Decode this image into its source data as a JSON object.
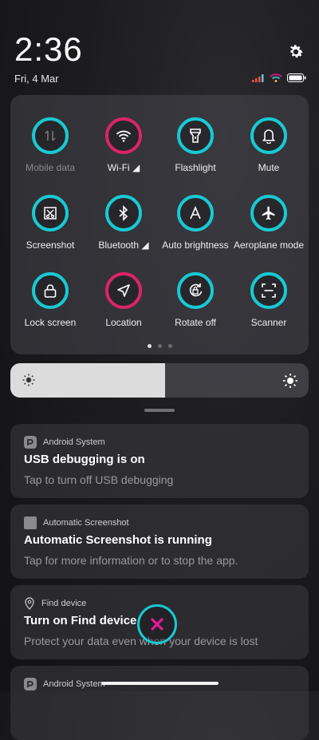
{
  "status": {
    "time": "2:36",
    "date": "Fri, 4 Mar"
  },
  "tiles": [
    {
      "label": "Mobile data",
      "icon": "mobile-data-icon",
      "active": false
    },
    {
      "label": "Wi-Fi ◢",
      "icon": "wifi-icon",
      "active": true
    },
    {
      "label": "Flashlight",
      "icon": "flashlight-icon",
      "active": false
    },
    {
      "label": "Mute",
      "icon": "bell-icon",
      "active": false
    },
    {
      "label": "Screenshot",
      "icon": "screenshot-icon",
      "active": false
    },
    {
      "label": "Bluetooth ◢",
      "icon": "bluetooth-icon",
      "active": false
    },
    {
      "label": "Auto brightness",
      "icon": "auto-brightness-icon",
      "active": false
    },
    {
      "label": "Aeroplane mode",
      "icon": "aeroplane-icon",
      "active": false
    },
    {
      "label": "Lock screen",
      "icon": "lock-icon",
      "active": false
    },
    {
      "label": "Location",
      "icon": "location-icon",
      "active": true
    },
    {
      "label": "Rotate off",
      "icon": "rotate-lock-icon",
      "active": false
    },
    {
      "label": "Scanner",
      "icon": "scanner-icon",
      "active": false
    }
  ],
  "brightness": {
    "level": 0.52
  },
  "notifications": [
    {
      "app": "Android System",
      "title": "USB debugging is on",
      "text": "Tap to turn off USB debugging"
    },
    {
      "app": "Automatic Screenshot",
      "title": "Automatic Screenshot is running",
      "text": "Tap for more information or to stop the app."
    },
    {
      "app": "Find device",
      "title": "Turn on Find device",
      "text": "Protect your data even when your device is lost"
    },
    {
      "app": "Android System",
      "title": "",
      "text": ""
    }
  ],
  "colors": {
    "accent": "#19c9d3",
    "active": "#d9246a",
    "fab_x": "#e6199b"
  }
}
